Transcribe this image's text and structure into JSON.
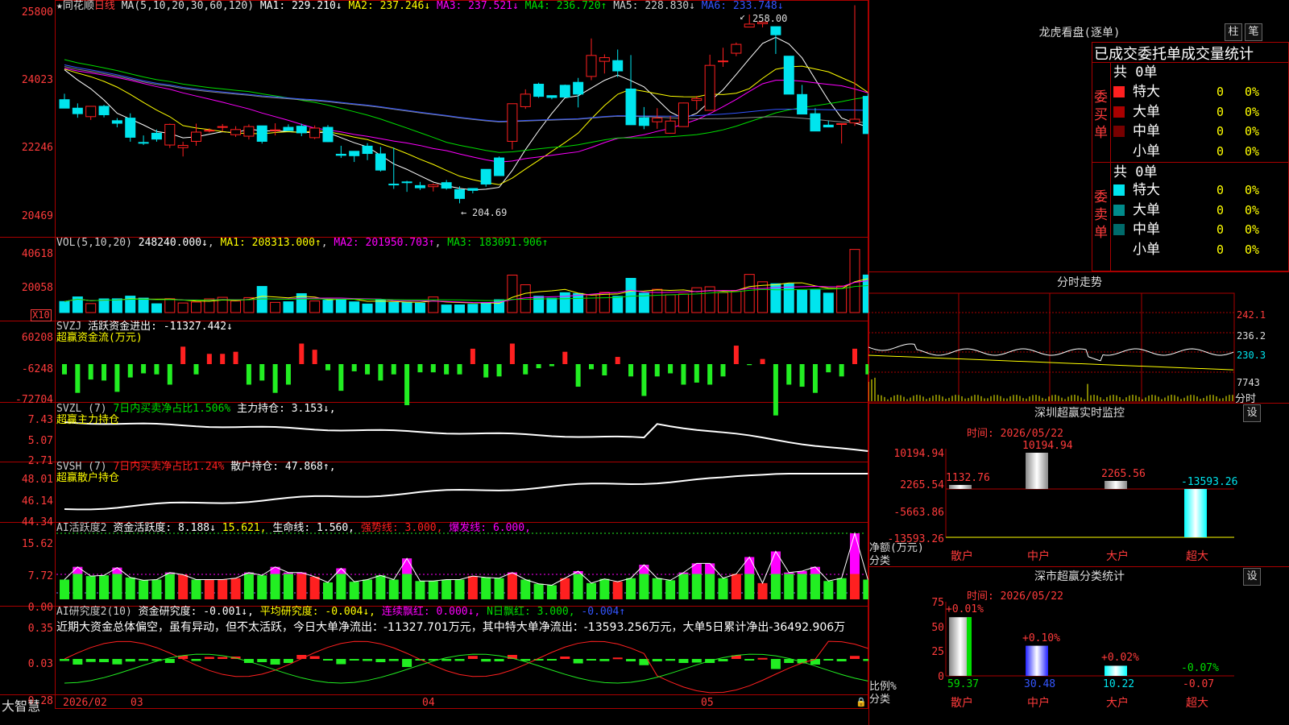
{
  "colors": {
    "up": "#ff2020",
    "down": "#00e5ee",
    "ma1": "#ffffff",
    "ma2": "#ffff00",
    "ma3": "#ff00ff",
    "ma4": "#00dd00",
    "ma5": "#8a8a8a",
    "ma6": "#3355ff",
    "grid": "#a00000",
    "money_up": "#ff2020",
    "money_down": "#22ee22",
    "pink": "#ff00ff"
  },
  "header": {
    "star": "★",
    "stock": "同花顺",
    "period": "日线",
    "ma_label": "MA(5,10,20,30,60,120)",
    "ma1": "MA1: 229.210↓",
    "ma2": "MA2: 237.246↓",
    "ma3": "MA3: 237.521↓",
    "ma4": "MA4: 236.720↑",
    "ma5": "MA5: 228.830↓",
    "ma6": "MA6: 233.748↓"
  },
  "price_axis": [
    "25800",
    "24023",
    "22246",
    "20469"
  ],
  "annotations": {
    "high": "258.00",
    "low": "204.69"
  },
  "vol": {
    "title": "VOL(5,10,20)",
    "value": "248240.000↓",
    "ma1": "MA1: 208313.000↑",
    "ma2": "MA2: 201950.703↑",
    "ma3": "MA3: 183091.906↑",
    "axis": [
      "40618",
      "20058"
    ],
    "unit": "X10"
  },
  "svzj": {
    "title": "SVZJ",
    "t1": "活跃资金进出: -11327.442↓",
    "sub": "超赢资金流(万元)",
    "axis": [
      "60208",
      "-6248",
      "-72704"
    ]
  },
  "svzl": {
    "title": "SVZL (7)",
    "t1": "7日内买卖净占比1.506%",
    "t2": "主力持仓: 3.153↓,",
    "sub": "超赢主力持仓",
    "axis": [
      "7.43",
      "5.07",
      "2.71"
    ]
  },
  "svsh": {
    "title": "SVSH (7)",
    "t1": "7日内买卖净占比1.24%",
    "t2": "散户持仓: 47.868↑,",
    "sub": "超赢散户持仓",
    "axis": [
      "48.01",
      "46.14",
      "44.34"
    ]
  },
  "ai1": {
    "title": "AI活跃度2",
    "t1": "资金活跃度: 8.188↓",
    "t2": "15.621,",
    "t3": "生命线: 1.560,",
    "t4": "强势线: 3.000,",
    "t5": "爆发线: 6.000,",
    "axis": [
      "15.62",
      "7.72",
      "0.00"
    ]
  },
  "ai2": {
    "title": "AI研究度2(10)",
    "t1": "资金研究度: -0.001↓,",
    "t2": "平均研究度: -0.004↓,",
    "t3": "连续飘红: 0.000↓,",
    "t4": "N日飘红: 3.000,",
    "t5": "-0.004↑",
    "axis": [
      "0.35",
      "0.03",
      "-0.28"
    ],
    "summary": "近期大资金总体偏空，虽有异动，但不太活跃，今日大单净流出：-11327.701万元，其中特大单净流出：-13593.256万元，大单5日累计净出-36492.906万"
  },
  "xaxis": {
    "app": "大智慧",
    "labels": [
      "2026/02",
      "03",
      "04",
      "05"
    ]
  },
  "right": {
    "lh_title": "龙虎看盘(逐单)",
    "btn_col": "柱",
    "btn_pen": "笔",
    "tabs": [
      "已成交委托单",
      "成交量统计"
    ],
    "buy": {
      "side": "委买单",
      "total": "共 0单",
      "rows": [
        {
          "label": "特大",
          "v": "0",
          "p": "0%"
        },
        {
          "label": "大单",
          "v": "0",
          "p": "0%"
        },
        {
          "label": "中单",
          "v": "0",
          "p": "0%"
        },
        {
          "label": "小单",
          "v": "0",
          "p": "0%"
        }
      ]
    },
    "sell": {
      "side": "委卖单",
      "total": "共 0单",
      "rows": [
        {
          "label": "特大",
          "v": "0",
          "p": "0%"
        },
        {
          "label": "大单",
          "v": "0",
          "p": "0%"
        },
        {
          "label": "中单",
          "v": "0",
          "p": "0%"
        },
        {
          "label": "小单",
          "v": "0",
          "p": "0%"
        }
      ]
    },
    "fs_title": "分时走势",
    "fs_axis": [
      "242.1",
      "236.2",
      "230.3",
      "7743"
    ],
    "fs_xlabel": "分时",
    "sz_title": "深圳超赢实时监控",
    "sz_set": "设",
    "sz_time": "时间: 2026/05/22",
    "sz_axis": [
      "10194.94",
      "2265.54",
      "-5663.86",
      "-13593.26"
    ],
    "sz_unit1": "净额(万元)",
    "sz_unit2": "分类",
    "sz_bars": [
      {
        "cat": "散户",
        "value": 1132.76,
        "label": "1132.76"
      },
      {
        "cat": "中户",
        "value": 10194.94,
        "label": "10194.94"
      },
      {
        "cat": "大户",
        "value": 2265.56,
        "label": "2265.56"
      },
      {
        "cat": "超大",
        "value": -13593.26,
        "label": "-13593.26"
      }
    ],
    "ss_title": "深市超赢分类统计",
    "ss_set": "设",
    "ss_time": "时间: 2026/05/22",
    "ss_axis": [
      "75",
      "50",
      "25",
      "0"
    ],
    "ss_unit1": "比例%",
    "ss_unit2": "分类",
    "ss_bars": [
      {
        "cat": "散户",
        "value": 59.37,
        "label": "59.37",
        "chg": "+0.01%"
      },
      {
        "cat": "中户",
        "value": 30.48,
        "label": "30.48",
        "chg": "+0.10%"
      },
      {
        "cat": "大户",
        "value": 10.22,
        "label": "10.22",
        "chg": "+0.02%"
      },
      {
        "cat": "超大",
        "value": -0.07,
        "label": "-0.07",
        "chg": "-0.07%"
      }
    ]
  },
  "chart_data": {
    "type": "candlestick",
    "title": "同花顺 日线",
    "ylim": [
      204.69,
      258.0
    ],
    "candles_ohl_c": [
      [
        234.9,
        236.5,
        232.6,
        232.6
      ],
      [
        232.6,
        233.9,
        230.0,
        231.1
      ],
      [
        230.3,
        233.2,
        229.4,
        233.1
      ],
      [
        233.1,
        233.5,
        230.1,
        230.8
      ],
      [
        229.2,
        229.9,
        227.4,
        228.5
      ],
      [
        229.9,
        231.2,
        223.5,
        224.7
      ],
      [
        223.3,
        225.2,
        222.6,
        223.1
      ],
      [
        225.8,
        226.8,
        223.5,
        224.2
      ],
      [
        222.6,
        228.4,
        221.8,
        228.2
      ],
      [
        221.9,
        223.5,
        219.5,
        222.5
      ],
      [
        223.6,
        228.4,
        222.4,
        226.1
      ],
      [
        226.4,
        227.1,
        226.0,
        226.6
      ],
      [
        227.5,
        228.3,
        226.3,
        227.6
      ],
      [
        225.4,
        227.7,
        224.8,
        226.8
      ],
      [
        225.0,
        228.2,
        224.1,
        227.6
      ],
      [
        227.8,
        226.0,
        223.0,
        223.6
      ],
      [
        226.6,
        228.5,
        225.2,
        226.7
      ],
      [
        227.4,
        228.2,
        226.5,
        226.5
      ],
      [
        227.7,
        228.4,
        225.0,
        225.9
      ],
      [
        224.6,
        227.9,
        224.2,
        227.2
      ],
      [
        227.4,
        228.0,
        223.4,
        223.5
      ],
      [
        220.1,
        222.4,
        219.1,
        219.8
      ],
      [
        220.9,
        220.6,
        218.0,
        219.7
      ],
      [
        222.3,
        223.1,
        218.5,
        220.3
      ],
      [
        220.2,
        222.1,
        215.4,
        215.8
      ],
      [
        212.0,
        221.9,
        210.7,
        211.8
      ],
      [
        212.6,
        212.9,
        209.9,
        212.4
      ],
      [
        211.6,
        212.6,
        210.4,
        211.0
      ],
      [
        211.3,
        212.2,
        210.0,
        211.8
      ],
      [
        212.4,
        213.1,
        210.5,
        210.9
      ],
      [
        210.5,
        211.4,
        206.8,
        208.1
      ],
      [
        210.8,
        210.8,
        209.5,
        210.3
      ],
      [
        216.0,
        215.8,
        211.3,
        212.0
      ],
      [
        219.1,
        219.5,
        214.2,
        214.3
      ],
      [
        223.6,
        233.8,
        221.4,
        233.8
      ],
      [
        233.0,
        237.7,
        232.4,
        236.4
      ],
      [
        239.1,
        239.5,
        235.4,
        235.8
      ],
      [
        236.0,
        235.7,
        235.0,
        235.5
      ],
      [
        238.8,
        239.0,
        237.4,
        235.6
      ],
      [
        239.6,
        240.8,
        232.8,
        236.4
      ],
      [
        241.2,
        251.5,
        240.2,
        246.9
      ],
      [
        245.3,
        247.2,
        242.0,
        246.3
      ],
      [
        245.5,
        248.5,
        241.0,
        242.7
      ],
      [
        237.8,
        247.0,
        229.3,
        228.1
      ],
      [
        230.0,
        232.9,
        226.9,
        227.9
      ],
      [
        228.9,
        232.6,
        227.0,
        229.9
      ],
      [
        225.8,
        230.5,
        225.7,
        229.1
      ],
      [
        227.6,
        234.1,
        228.5,
        234.0
      ],
      [
        234.7,
        235.9,
        232.1,
        235.2
      ],
      [
        232.0,
        247.1,
        231.9,
        244.2
      ],
      [
        245.2,
        249.0,
        243.8,
        245.4
      ],
      [
        247.5,
        250.4,
        246.7,
        249.9
      ],
      [
        254.6,
        258.0,
        255.0,
        255.4
      ],
      [
        255.5,
        255.6,
        254.5,
        255.9
      ],
      [
        254.7,
        252.3,
        247.3,
        252.5
      ],
      [
        246.7,
        245.3,
        240.4,
        236.4
      ],
      [
        236.3,
        238.9,
        232.3,
        231.0
      ],
      [
        231.1,
        232.6,
        229.7,
        226.4
      ],
      [
        228.0,
        229.2,
        227.4,
        227.5
      ],
      [
        228.4,
        226.8,
        223.0,
        228.4
      ],
      [
        228.6,
        260.5,
        227.8,
        229.6
      ],
      [
        235.8,
        236.6,
        228.5,
        225.7
      ]
    ],
    "volume": [
      127,
      180,
      103,
      157,
      158,
      189,
      166,
      101,
      159,
      110,
      121,
      157,
      175,
      133,
      172,
      300,
      117,
      124,
      217,
      133,
      142,
      150,
      123,
      98,
      148,
      116,
      117,
      108,
      179,
      87,
      88,
      95,
      113,
      147,
      430,
      319,
      187,
      165,
      228,
      219,
      202,
      232,
      186,
      393,
      223,
      267,
      205,
      214,
      285,
      296,
      227,
      246,
      438,
      353,
      331,
      331,
      255,
      260,
      223,
      305,
      725,
      431
    ],
    "money_flow": [
      -10000,
      -28000,
      -15000,
      -16000,
      -27000,
      -13000,
      -9000,
      -10000,
      -20000,
      17000,
      -10000,
      10000,
      10000,
      12000,
      -20000,
      -16000,
      -28000,
      -20000,
      20000,
      14000,
      -6000,
      -26000,
      -7000,
      -10000,
      -16000,
      -10000,
      -40000,
      -8000,
      -8000,
      -10000,
      -10000,
      15000,
      -13000,
      -12000,
      20000,
      -10000,
      -4000,
      -2000,
      12000,
      -22000,
      -5000,
      -11000,
      7000,
      -12000,
      -31000,
      -12000,
      -9000,
      -20000,
      -18000,
      -20000,
      -12000,
      18000,
      -1000,
      5000,
      -50000,
      -20000,
      -22000,
      -28000,
      -8000,
      -12000,
      15000,
      -10000
    ]
  }
}
